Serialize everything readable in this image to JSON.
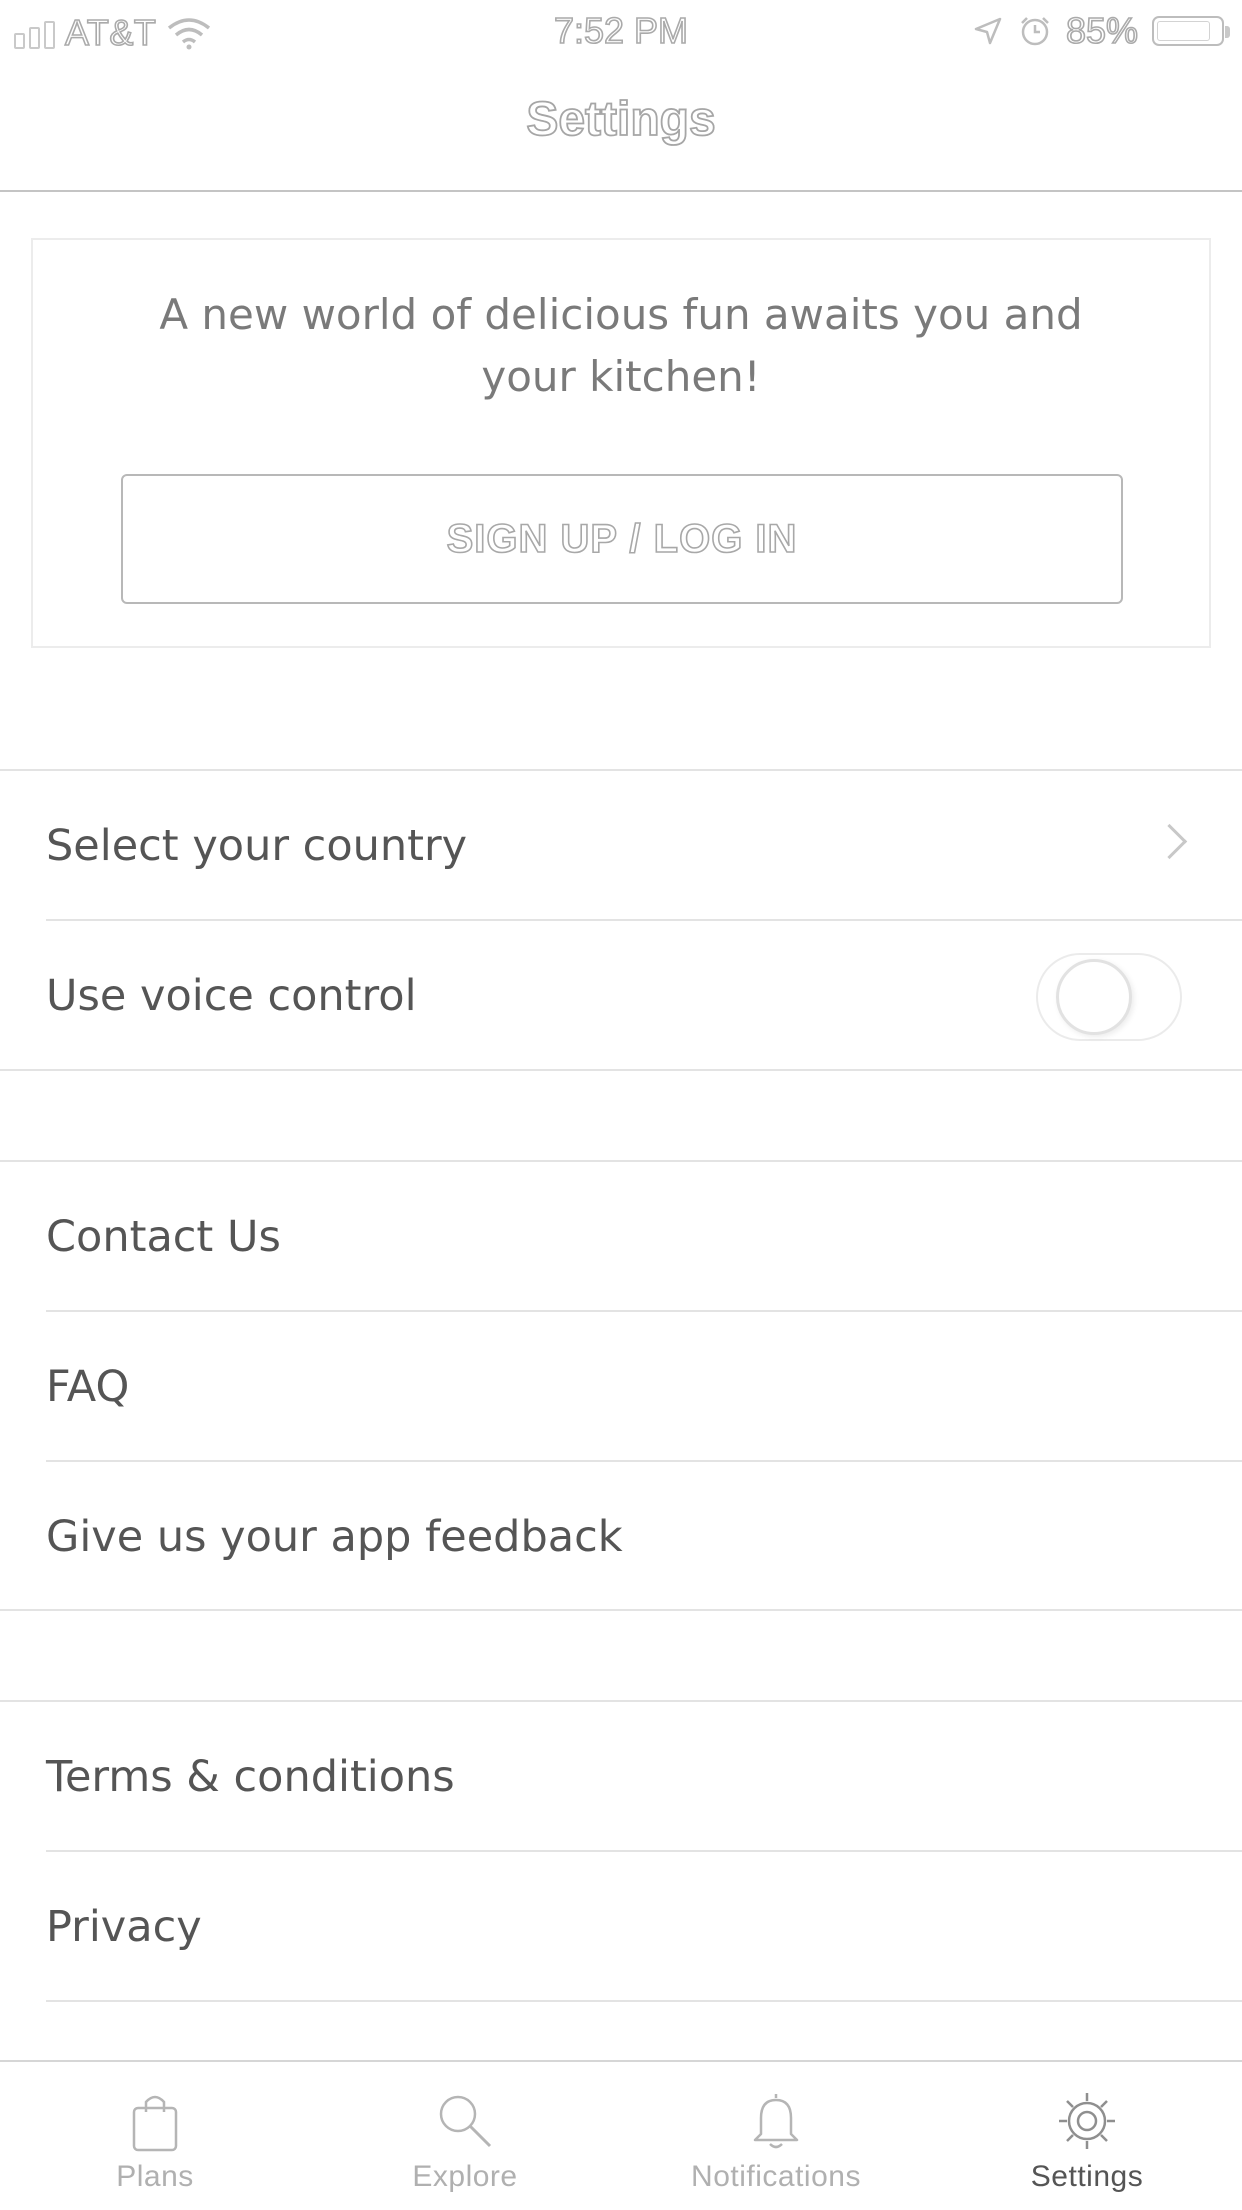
{
  "status_bar": {
    "carrier": "AT&T",
    "time": "7:52 PM",
    "battery_percent": "85%",
    "battery_level": 0.85
  },
  "header": {
    "title": "Settings"
  },
  "promo": {
    "text": "A new world of delicious fun awaits you and your kitchen!",
    "button_label": "SIGN UP / LOG IN"
  },
  "settings_group_1": [
    {
      "label": "Select your country",
      "accessory": "chevron"
    },
    {
      "label": "Use voice control",
      "accessory": "toggle",
      "toggle_on": false
    }
  ],
  "settings_group_2": [
    {
      "label": "Contact Us"
    },
    {
      "label": "FAQ"
    },
    {
      "label": "Give us your app feedback"
    }
  ],
  "settings_group_3": [
    {
      "label": "Terms & conditions"
    },
    {
      "label": "Privacy"
    }
  ],
  "tab_bar": [
    {
      "label": "Plans",
      "icon": "shopping-bag-icon",
      "active": false
    },
    {
      "label": "Explore",
      "icon": "search-icon",
      "active": false
    },
    {
      "label": "Notifications",
      "icon": "bell-icon",
      "active": false
    },
    {
      "label": "Settings",
      "icon": "gear-icon",
      "active": true
    }
  ]
}
